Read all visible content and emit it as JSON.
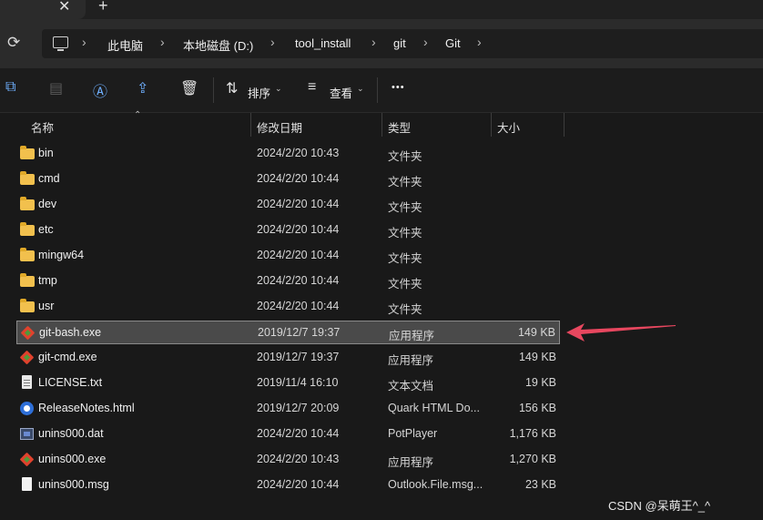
{
  "tabs": {
    "close_glyph": "✕",
    "new_glyph": "+"
  },
  "address": {
    "crumbs": [
      "此电脑",
      "本地磁盘 (D:)",
      "tool_install",
      "git",
      "Git"
    ],
    "separator": "›"
  },
  "toolbar": {
    "sort_label": "排序",
    "view_label": "查看",
    "more_glyph": "•••",
    "chevron": "⌄"
  },
  "columns": {
    "name": "名称",
    "date": "修改日期",
    "type": "类型",
    "size": "大小"
  },
  "files": [
    {
      "name": "bin",
      "date": "2024/2/20 10:43",
      "type": "文件夹",
      "size": "",
      "icon": "folder-icon"
    },
    {
      "name": "cmd",
      "date": "2024/2/20 10:44",
      "type": "文件夹",
      "size": "",
      "icon": "folder-icon"
    },
    {
      "name": "dev",
      "date": "2024/2/20 10:44",
      "type": "文件夹",
      "size": "",
      "icon": "folder-icon"
    },
    {
      "name": "etc",
      "date": "2024/2/20 10:44",
      "type": "文件夹",
      "size": "",
      "icon": "folder-icon"
    },
    {
      "name": "mingw64",
      "date": "2024/2/20 10:44",
      "type": "文件夹",
      "size": "",
      "icon": "folder-icon"
    },
    {
      "name": "tmp",
      "date": "2024/2/20 10:44",
      "type": "文件夹",
      "size": "",
      "icon": "folder-icon"
    },
    {
      "name": "usr",
      "date": "2024/2/20 10:44",
      "type": "文件夹",
      "size": "",
      "icon": "folder-icon"
    },
    {
      "name": "git-bash.exe",
      "date": "2019/12/7 19:37",
      "type": "应用程序",
      "size": "149 KB",
      "icon": "git-icon"
    },
    {
      "name": "git-cmd.exe",
      "date": "2019/12/7 19:37",
      "type": "应用程序",
      "size": "149 KB",
      "icon": "git-icon"
    },
    {
      "name": "LICENSE.txt",
      "date": "2019/11/4 16:10",
      "type": "文本文档",
      "size": "19 KB",
      "icon": "txt-icon"
    },
    {
      "name": "ReleaseNotes.html",
      "date": "2019/12/7 20:09",
      "type": "Quark HTML Do...",
      "size": "156 KB",
      "icon": "html-icon"
    },
    {
      "name": "unins000.dat",
      "date": "2024/2/20 10:44",
      "type": "PotPlayer",
      "size": "1,176 KB",
      "icon": "dat-icon"
    },
    {
      "name": "unins000.exe",
      "date": "2024/2/20 10:43",
      "type": "应用程序",
      "size": "1,270 KB",
      "icon": "git-icon"
    },
    {
      "name": "unins000.msg",
      "date": "2024/2/20 10:44",
      "type": "Outlook.File.msg...",
      "size": "23 KB",
      "icon": "msg-icon"
    }
  ],
  "selected_file": "git-bash.exe",
  "colors": {
    "accent": "#6fb0ff",
    "arrow": "#e8475f",
    "folder": "#f2c04d"
  },
  "watermark": "CSDN @呆萌王^_^"
}
